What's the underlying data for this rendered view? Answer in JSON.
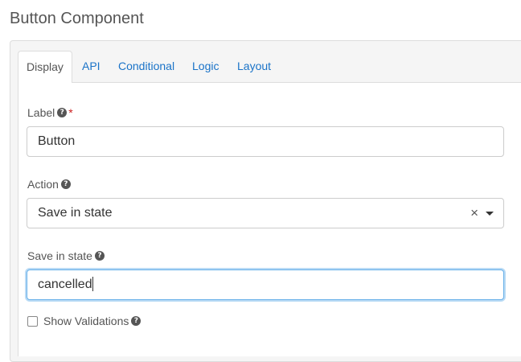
{
  "page": {
    "title": "Button Component"
  },
  "tabs": [
    {
      "label": "Display",
      "active": true
    },
    {
      "label": "API",
      "active": false
    },
    {
      "label": "Conditional",
      "active": false
    },
    {
      "label": "Logic",
      "active": false
    },
    {
      "label": "Layout",
      "active": false
    }
  ],
  "fields": {
    "label": {
      "label": "Label",
      "required_marker": "*",
      "value": "Button"
    },
    "action": {
      "label": "Action",
      "selected": "Save in state",
      "clear_glyph": "×"
    },
    "save_in_state": {
      "label": "Save in state",
      "value": "cancelled"
    },
    "show_validations": {
      "label": "Show Validations",
      "checked": false
    }
  },
  "icons": {
    "help": "question-circle-icon",
    "help_glyph": "?"
  },
  "colors": {
    "link": "#1a73c8",
    "required": "#cc2222",
    "focus": "#66afe9"
  }
}
